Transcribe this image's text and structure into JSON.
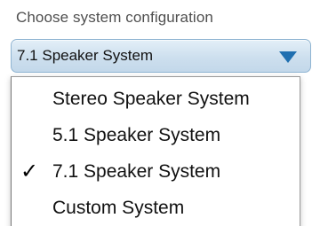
{
  "field": {
    "label": "Choose system configuration"
  },
  "select": {
    "selected_value": "7.1 Speaker System",
    "arrow_icon": "triangle-down-icon",
    "accent_color": "#1f6fb0"
  },
  "dropdown": {
    "options": [
      {
        "label": "Stereo Speaker System",
        "checked": false,
        "check_mark": ""
      },
      {
        "label": "5.1 Speaker System",
        "checked": false,
        "check_mark": ""
      },
      {
        "label": "7.1 Speaker System",
        "checked": true,
        "check_mark": "✓"
      },
      {
        "label": "Custom System",
        "checked": false,
        "check_mark": ""
      }
    ]
  }
}
